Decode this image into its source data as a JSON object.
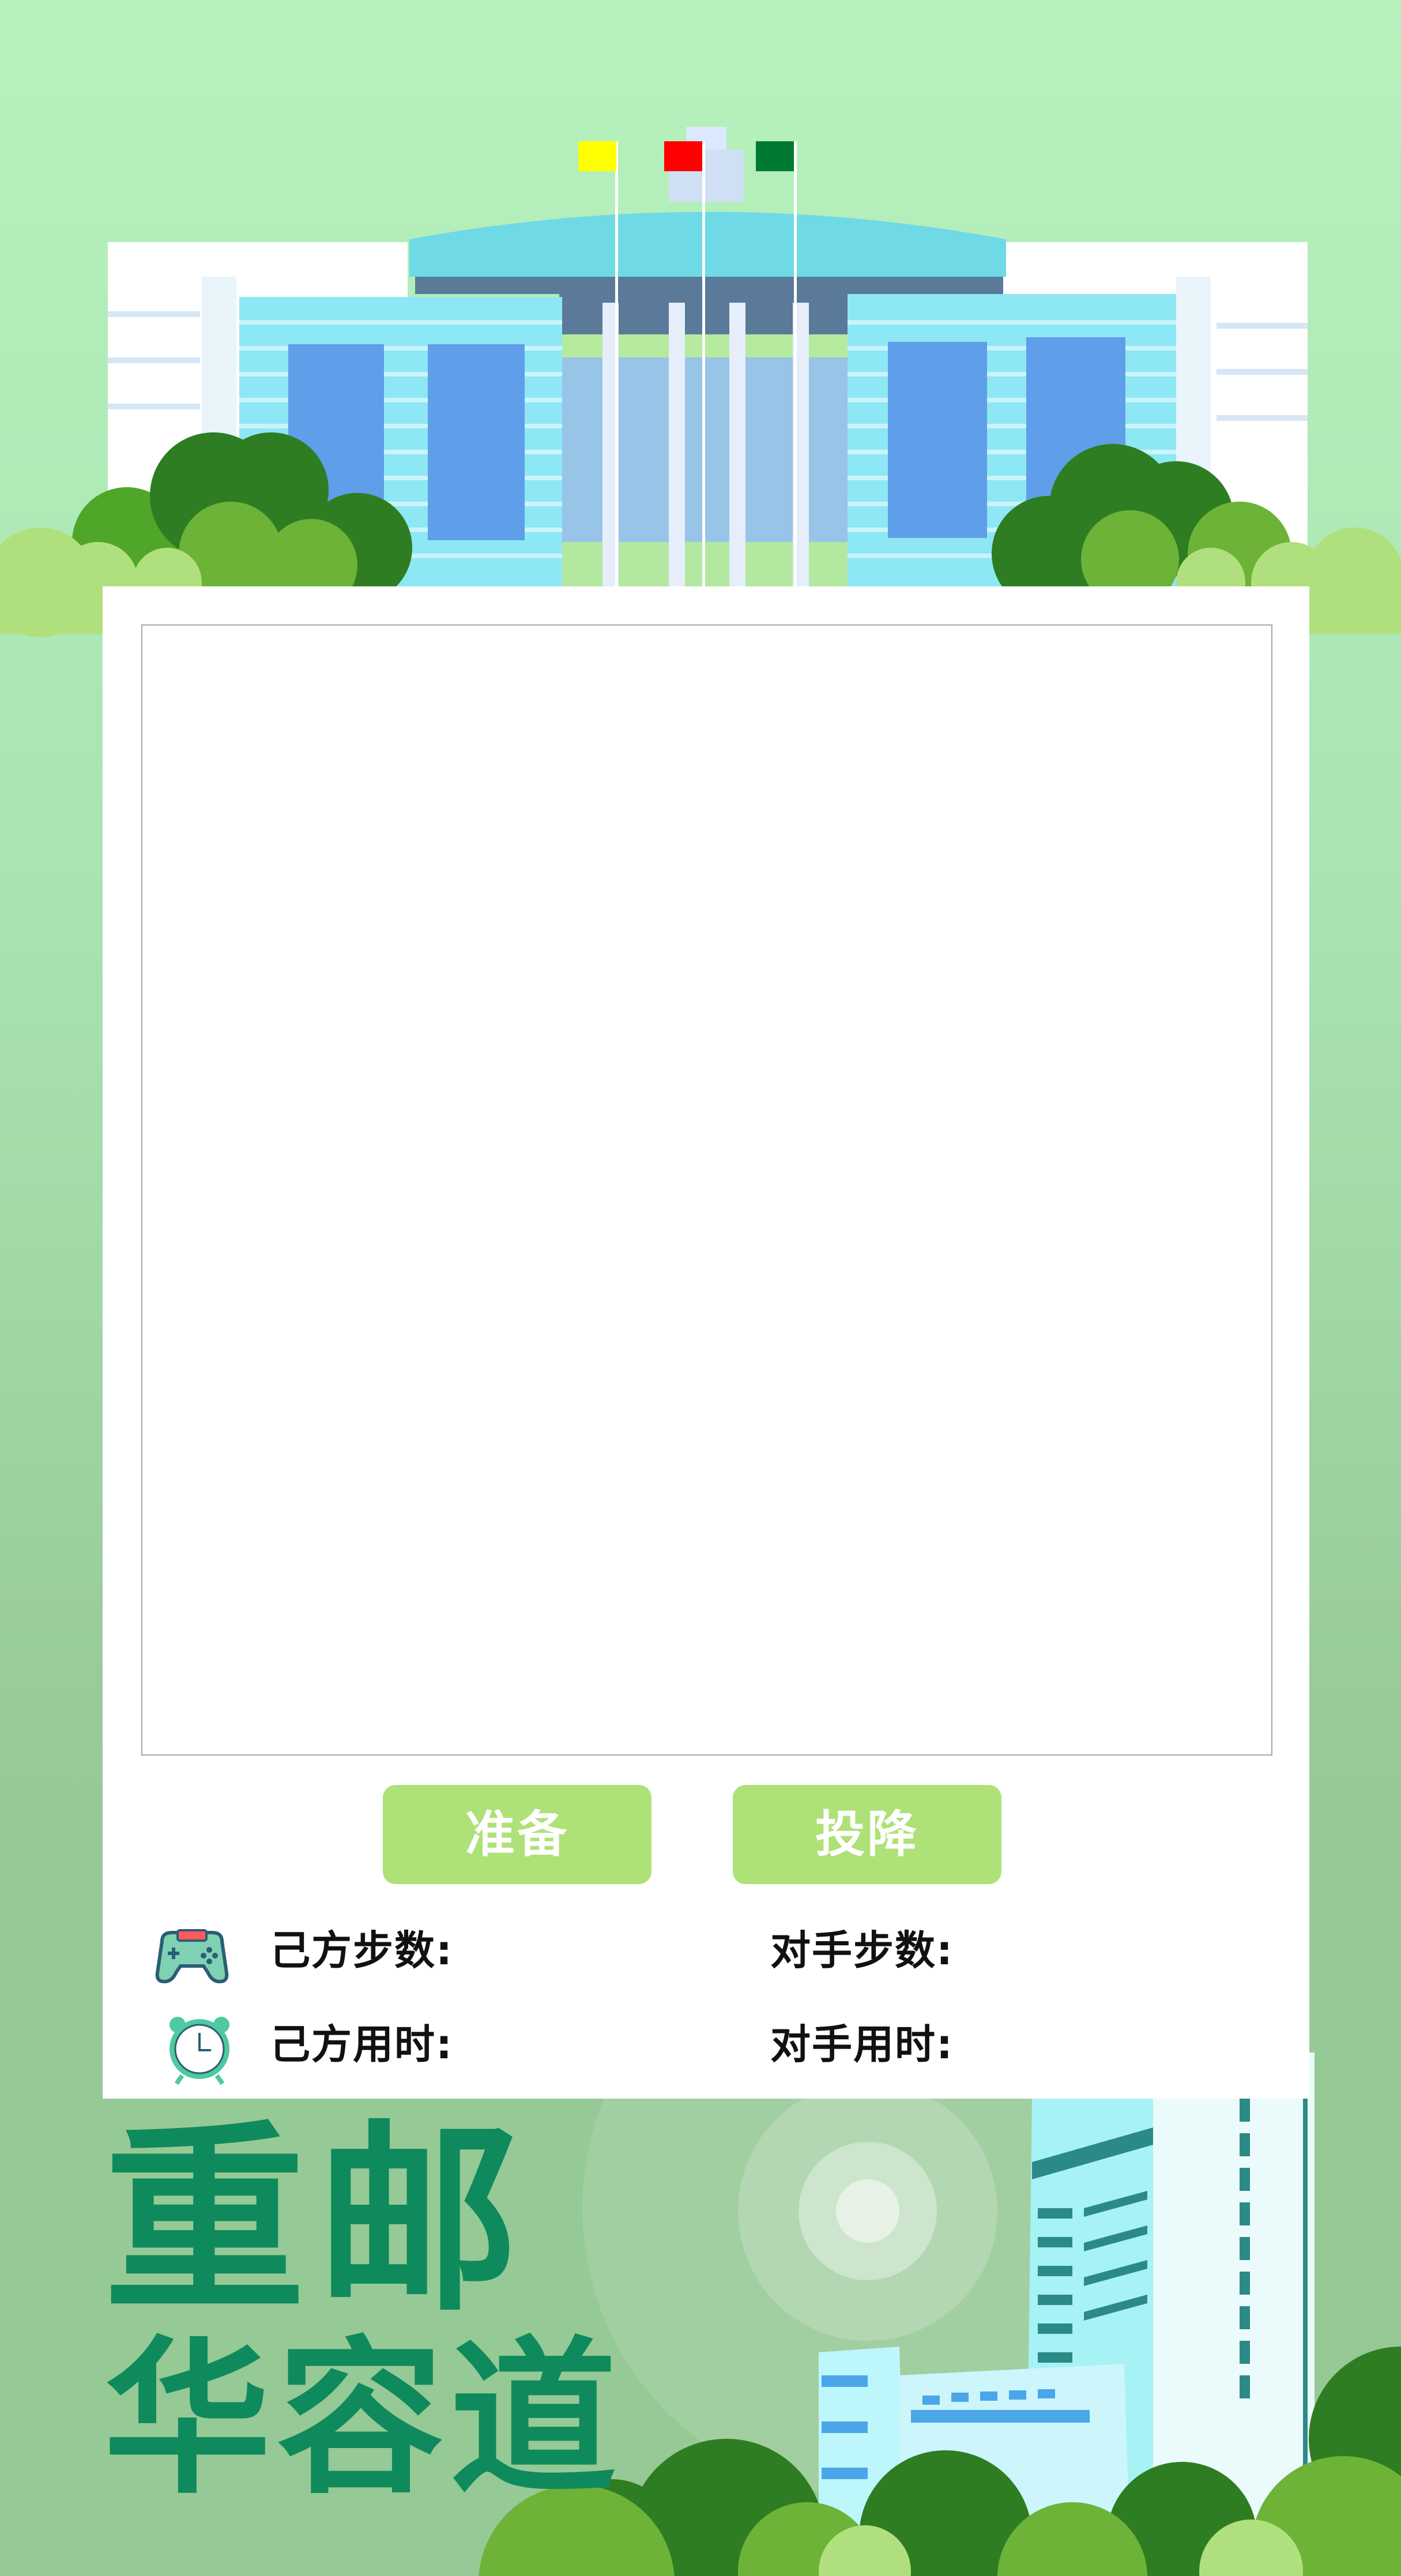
{
  "buttons": {
    "ready": "准备",
    "surrender": "投降"
  },
  "stats": {
    "my_steps_label": "己方步数:",
    "opponent_steps_label": "对手步数:",
    "my_time_label": "己方用时:",
    "opponent_time_label": "对手用时:",
    "my_steps_value": "",
    "opponent_steps_value": "",
    "my_time_value": "",
    "opponent_time_value": ""
  },
  "brand": {
    "title_line1": "重邮",
    "title_line2": "华容道"
  },
  "icons": {
    "steps": "gamepad-icon",
    "time": "alarm-clock-icon"
  },
  "colors": {
    "button_green": "#aee177",
    "title_green": "#0f8a5c",
    "flag_left": "#ffff00",
    "flag_middle": "#ff0000",
    "flag_right": "#007a33"
  }
}
